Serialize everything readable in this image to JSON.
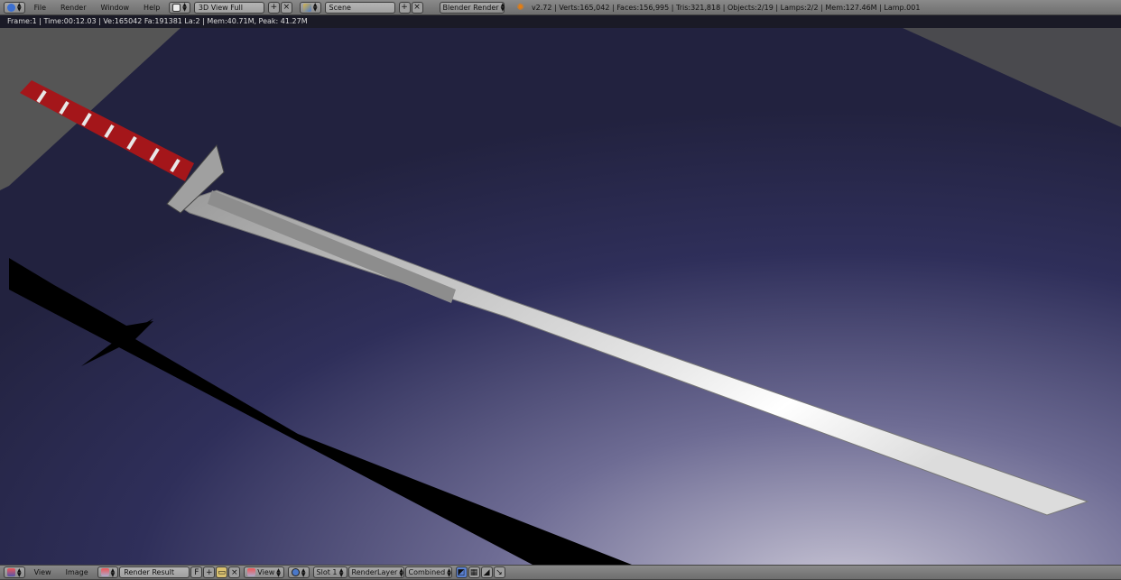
{
  "top_bar": {
    "menus": [
      "File",
      "Render",
      "Window",
      "Help"
    ],
    "screen_layout": "3D View Full",
    "scene": "Scene",
    "render_engine": "Blender Render",
    "stats": "v2.72 | Verts:165,042 | Faces:156,995 | Tris:321,818 | Objects:2/19 | Lamps:2/2 | Mem:127.46M | Lamp.001"
  },
  "render_info": "Frame:1 | Time:00:12.03 | Ve:165042 Fa:191381 La:2 | Mem:40.71M, Peak: 41.27M",
  "bottom_bar": {
    "menus": [
      "View",
      "Image"
    ],
    "image_name": "Render Result",
    "fake_user": "F",
    "view_label": "View",
    "slot": "Slot 1",
    "render_layer": "RenderLayer",
    "pass": "Combined"
  }
}
